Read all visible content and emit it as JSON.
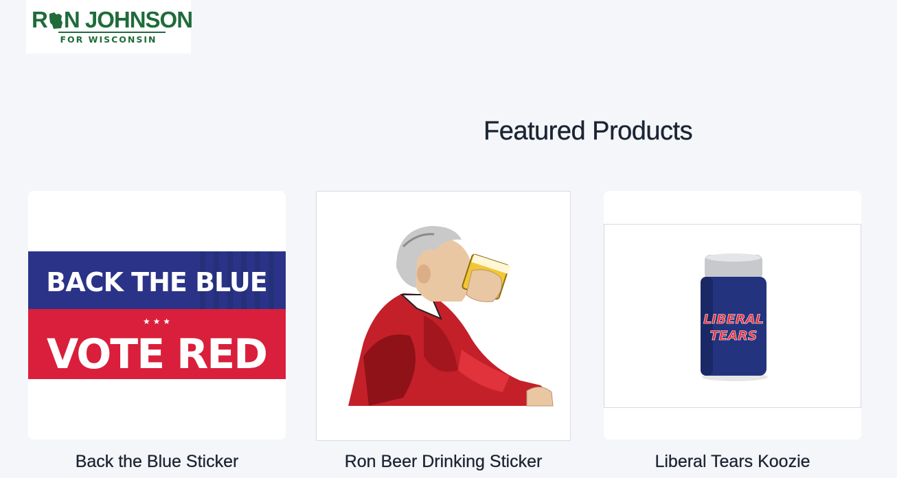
{
  "brand": {
    "name_left": "R",
    "name_right": "N JOHNSON",
    "subtitle": "FOR WISCONSIN",
    "color": "#1f6b3a"
  },
  "main": {
    "section_title": "Featured Products"
  },
  "products": [
    {
      "name": "Back the Blue Sticker",
      "image_text_top": "BACK THE BLUE",
      "image_text_bottom": "VOTE RED",
      "image_stars": "★ ★ ★"
    },
    {
      "name": "Ron Beer Drinking Sticker"
    },
    {
      "name": "Liberal Tears Koozie",
      "image_text_line1": "LIBERAL",
      "image_text_line2": "TEARS"
    }
  ],
  "colors": {
    "background": "#f5f6fa",
    "sticker_blue": "#2b3388",
    "sticker_red": "#d91f3b",
    "koozie_blue": "#23337e"
  }
}
